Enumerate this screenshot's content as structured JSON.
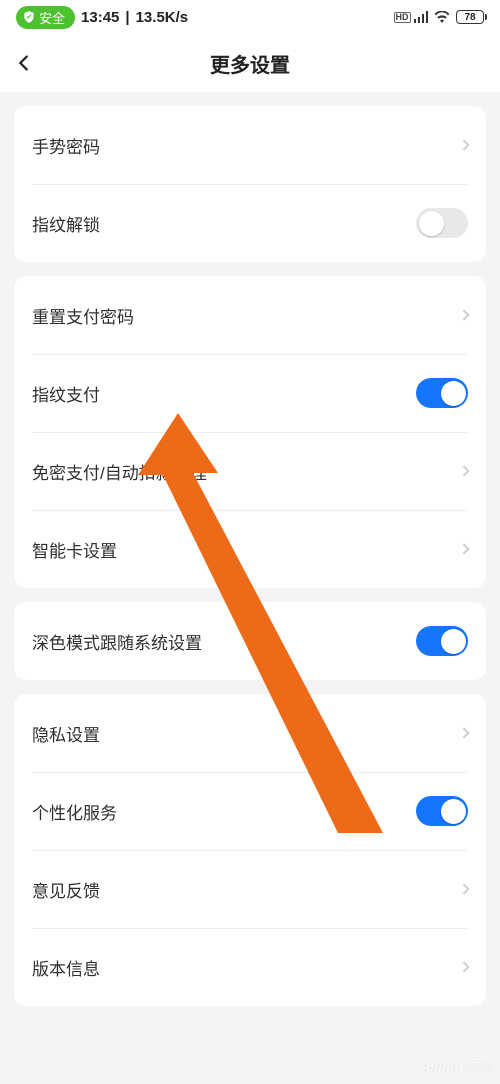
{
  "status_bar": {
    "safety_label": "安全",
    "time": "13:45",
    "net_speed": "13.5K/s",
    "hd": "HD",
    "battery": "78"
  },
  "header": {
    "title": "更多设置"
  },
  "groups": [
    {
      "rows": [
        {
          "id": "gesture-password",
          "label": "手势密码",
          "kind": "nav"
        },
        {
          "id": "fingerprint-unlock",
          "label": "指纹解锁",
          "kind": "toggle",
          "value": false
        }
      ]
    },
    {
      "rows": [
        {
          "id": "reset-pay-pwd",
          "label": "重置支付密码",
          "kind": "nav"
        },
        {
          "id": "fingerprint-pay",
          "label": "指纹支付",
          "kind": "toggle",
          "value": true
        },
        {
          "id": "autopay-mgmt",
          "label": "免密支付/自动扣款管理",
          "kind": "nav"
        },
        {
          "id": "smartcard",
          "label": "智能卡设置",
          "kind": "nav"
        }
      ]
    },
    {
      "rows": [
        {
          "id": "dark-follow-system",
          "label": "深色模式跟随系统设置",
          "kind": "toggle",
          "value": true
        }
      ]
    },
    {
      "rows": [
        {
          "id": "privacy",
          "label": "隐私设置",
          "kind": "nav"
        },
        {
          "id": "personalized",
          "label": "个性化服务",
          "kind": "toggle",
          "value": true
        },
        {
          "id": "feedback",
          "label": "意见反馈",
          "kind": "nav"
        },
        {
          "id": "version",
          "label": "版本信息",
          "kind": "nav"
        }
      ]
    }
  ],
  "annotation": {
    "arrow_color": "#ed6a18"
  },
  "watermark": "Baidu 经验"
}
